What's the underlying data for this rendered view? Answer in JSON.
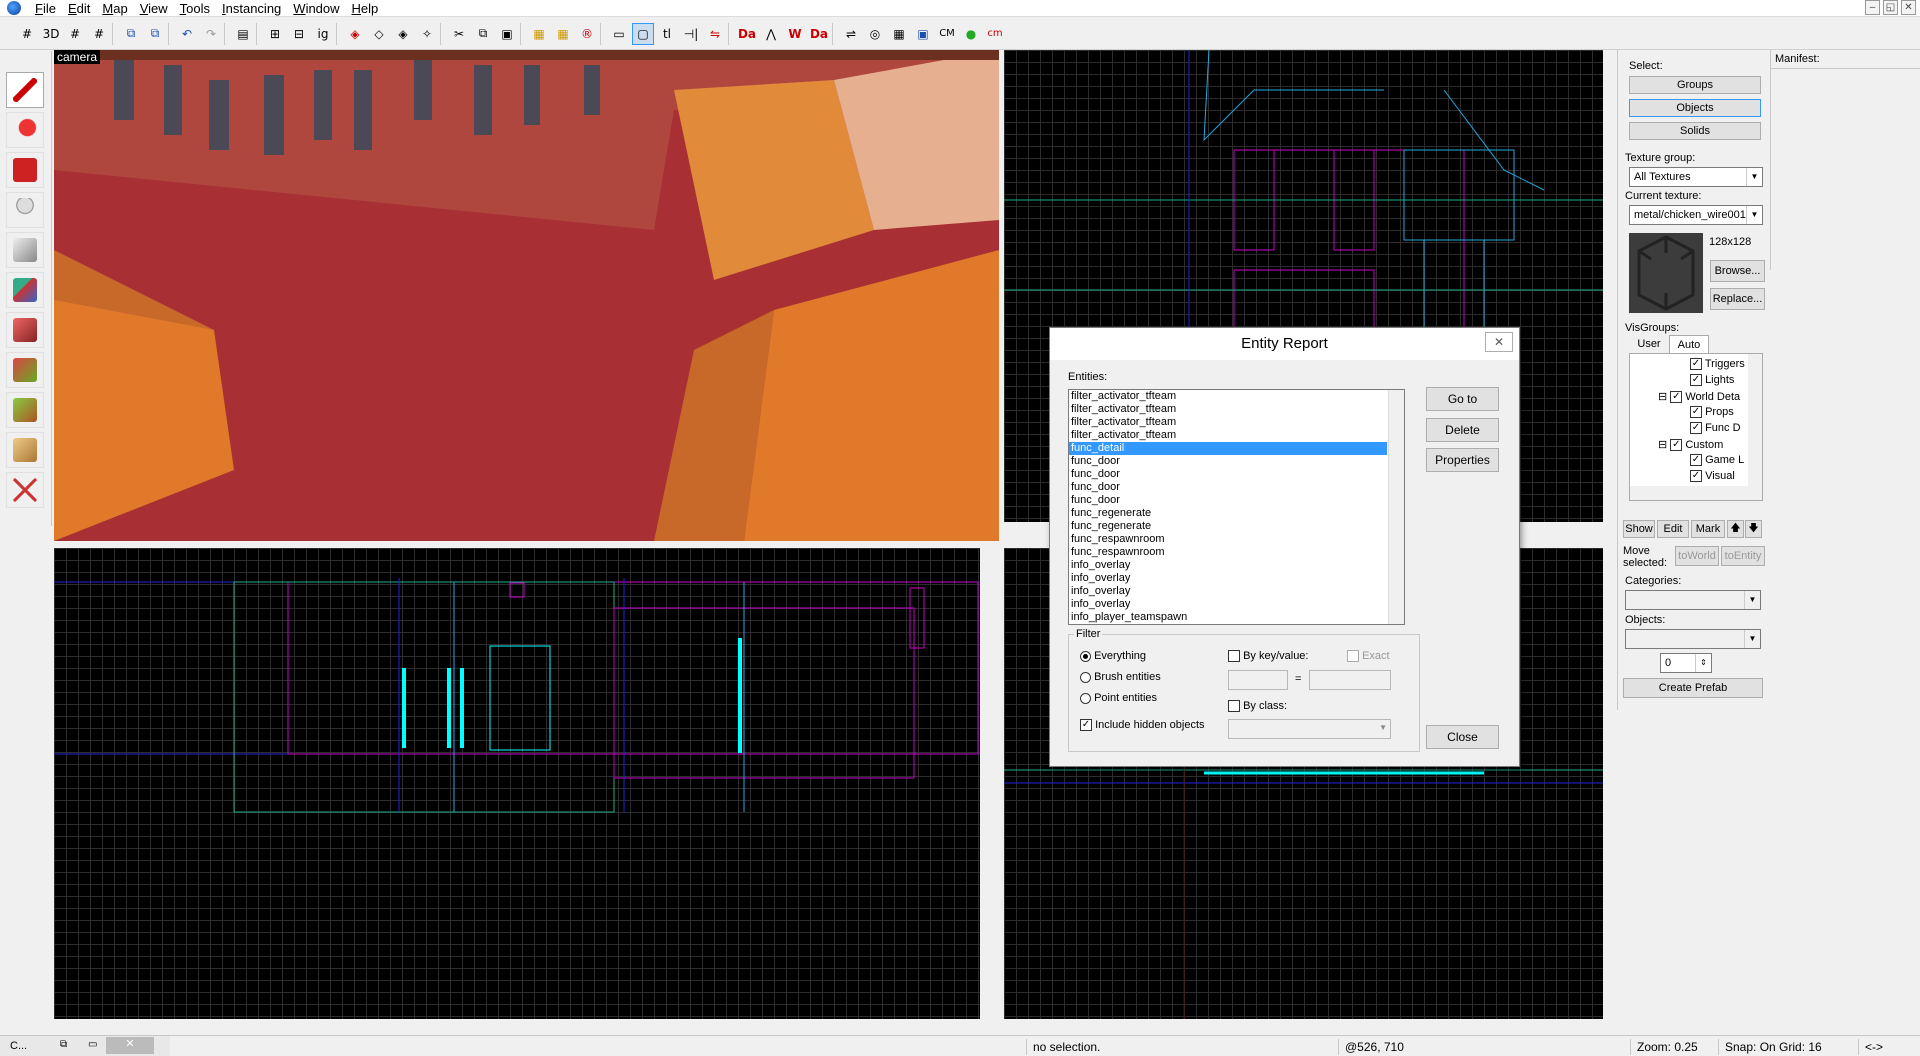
{
  "menu": [
    "File",
    "Edit",
    "Map",
    "View",
    "Tools",
    "Instancing",
    "Window",
    "Help"
  ],
  "window_controls": [
    "–",
    "◱",
    "✕"
  ],
  "toolbar": [
    "#",
    "3D",
    "#",
    "#",
    "⧉",
    "⧉",
    "↶",
    "↷",
    "▤",
    "⊞",
    "⊟",
    "ig",
    "◈",
    "◇",
    "◈",
    "✧",
    "✂",
    "⧉",
    "▣",
    "▦",
    "▦",
    "®",
    "▭",
    "▢",
    "tl",
    "⊣|",
    "⇋",
    "Da",
    "⋀",
    "W",
    "Da",
    "⇌",
    "◎",
    "▦",
    "▣",
    "CM",
    "●",
    "cm"
  ],
  "camera": {
    "label": "camera"
  },
  "dialog": {
    "title": "Entity Report",
    "close": "✕",
    "entities_label": "Entities:",
    "entities": [
      "filter_activator_tfteam",
      "filter_activator_tfteam",
      "filter_activator_tfteam",
      "filter_activator_tfteam",
      "func_detail",
      "func_door",
      "func_door",
      "func_door",
      "func_door",
      "func_regenerate",
      "func_regenerate",
      "func_respawnroom",
      "func_respawnroom",
      "info_overlay",
      "info_overlay",
      "info_overlay",
      "info_overlay",
      "info_player_teamspawn"
    ],
    "selected_entity": "func_detail",
    "buttons": {
      "goto": "Go to",
      "delete": "Delete",
      "properties": "Properties",
      "close": "Close"
    },
    "filter": {
      "label": "Filter",
      "everything": "Everything",
      "brush": "Brush entities",
      "point": "Point entities",
      "hidden": "Include hidden objects",
      "by_keyvalue": "By key/value:",
      "exact": "Exact",
      "equals": "=",
      "by_class": "By class:"
    }
  },
  "right_panel": {
    "select_label": "Select:",
    "groups": "Groups",
    "objects": "Objects",
    "solids": "Solids",
    "texture_group_label": "Texture group:",
    "texture_group_value": "All Textures",
    "current_texture_label": "Current texture:",
    "current_texture_value": "metal/chicken_wire001",
    "texture_size": "128x128",
    "browse": "Browse...",
    "replace": "Replace...",
    "visgroups_label": "VisGroups:",
    "tab_user": "User",
    "tab_auto": "Auto",
    "visgroups": [
      "Triggers",
      "Lights",
      "World Deta",
      "Props",
      "Func D",
      "Custom",
      "Game L",
      "Visual"
    ],
    "show": "Show",
    "edit": "Edit",
    "mark": "Mark",
    "up": "🡅",
    "down": "🡇",
    "move_selected": "Move selected:",
    "to_world": "toWorld",
    "to_entity": "toEntity",
    "categories_label": "Categories:",
    "objects_label": "Objects:",
    "spin_value": "0",
    "create_prefab": "Create Prefab"
  },
  "manifest": {
    "label": "Manifest:"
  },
  "status": {
    "selection": "no selection.",
    "coords": "@526, 710",
    "zoom": "Zoom: 0.25",
    "snap": "Snap: On Grid: 16",
    "arrows": "<->"
  },
  "taskbar": {
    "app": "C..."
  }
}
